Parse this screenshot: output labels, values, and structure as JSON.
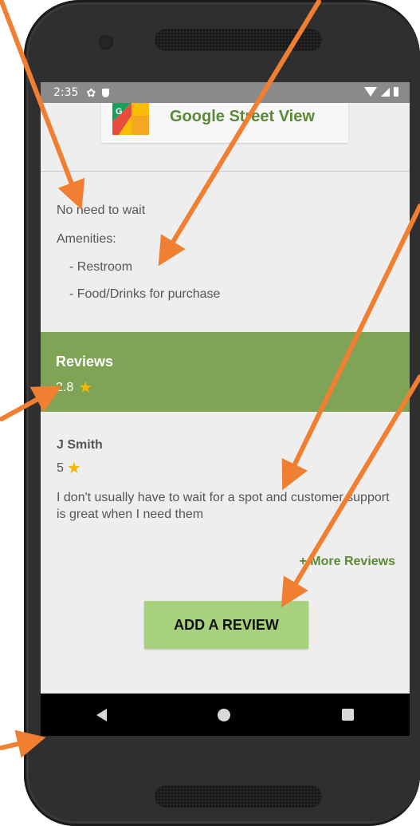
{
  "status_bar": {
    "time": "2:35"
  },
  "street_view": {
    "title": "Google Street View"
  },
  "details": {
    "wait": "No need to wait",
    "amenities_label": "Amenities:",
    "amenities": [
      "- Restroom",
      "- Food/Drinks for purchase"
    ]
  },
  "reviews": {
    "title": "Reviews",
    "average": "2.8",
    "items": [
      {
        "author": "J Smith",
        "score": "5",
        "text": "I don't usually have to wait for a spot and customer support is great when I need them"
      }
    ],
    "more_label": "+ More Reviews",
    "add_label": "ADD A REVIEW"
  },
  "colors": {
    "accent_green": "#7fa455",
    "link_green": "#5a8a34",
    "button_green": "#a8d17d",
    "star": "#f5b800",
    "annotation_arrow": "#f07f32"
  }
}
